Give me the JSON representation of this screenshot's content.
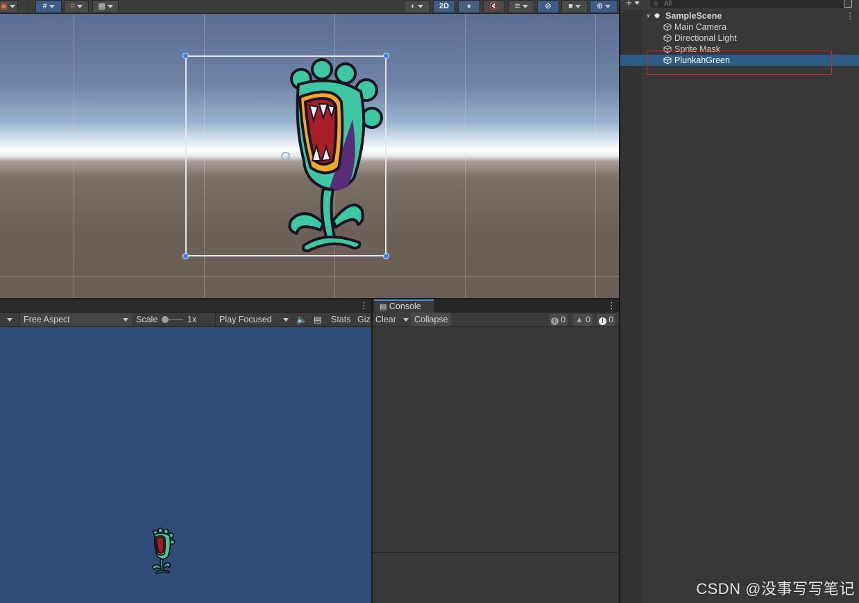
{
  "scene_view": {
    "toolbar": {
      "mode_2d_label": "2D"
    },
    "selected_sprite": "PlunkahGreen"
  },
  "game_view": {
    "aspect_label": "Free Aspect",
    "scale_label": "Scale",
    "scale_value": "1x",
    "play_mode_label": "Play Focused",
    "stats_label": "Stats",
    "gizmos_label": "Giz"
  },
  "console": {
    "tab_label": "Console",
    "clear_label": "Clear",
    "collapse_label": "Collapse",
    "log_count": "0",
    "warning_count": "0",
    "error_count": "0"
  },
  "hierarchy": {
    "search_placeholder": "All",
    "scene_name": "SampleScene",
    "objects": [
      {
        "label": "Main Camera"
      },
      {
        "label": "Directional Light"
      },
      {
        "label": "Sprite Mask"
      },
      {
        "label": "PlunkahGreen",
        "selected": true
      }
    ]
  },
  "watermark": "CSDN @没事写写笔记",
  "colors": {
    "selection_blue": "#2c5d87",
    "game_background": "#2f4c79",
    "annotation_red": "#e02020"
  }
}
